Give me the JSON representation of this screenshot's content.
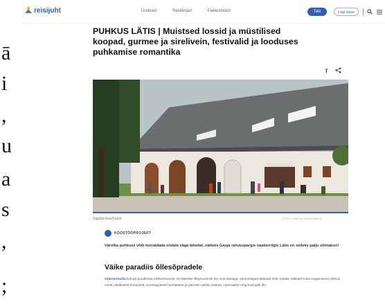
{
  "background_text": {
    "chars": [
      "ā",
      "i",
      ",",
      "u",
      "a",
      "s",
      ",",
      ";"
    ]
  },
  "header": {
    "logo": "reisijuht",
    "nav": [
      "Uudised",
      "Reisikirjad",
      "Pakkumised"
    ],
    "primary_button": "Telli",
    "login_button": "Logi sisse"
  },
  "article": {
    "title": "PUHKUS LÄTIS | Muistsed lossid ja müstilised koopad, gurmee ja sirelivein, festivalid ja looduses puhkamise romantika",
    "image_caption": "Sigulda loss/Kartal",
    "image_credit": "FOTO: SALLA RAIKKONEN",
    "promo_label": "KOOSTÖÖPROJEKT",
    "lead": "Värvika puhkuse võib korraldada endale väga lähedal, näiteks Gauja rahvuspargis naaberriigis Lätis on selleks palju võimalusi!",
    "subheading": "Väike paradiis õllesõpradele",
    "body_link": "Valmiermuiža",
    "body_text": " kutsub pruulikotta ekskursioonile, et näeksite õllepruulimist ise oma silmaga. Juhuvestjad näitavad teile, kuidas Valmiermuiža sügavustest võetud veest, täidlastest linnastest, suursugustest humalatest ja pärmist valmib maitsev, naturaalne ning kuninglik õlu."
  },
  "colors": {
    "accent": "#2f5fb8",
    "logo_yellow": "#f0b400"
  }
}
